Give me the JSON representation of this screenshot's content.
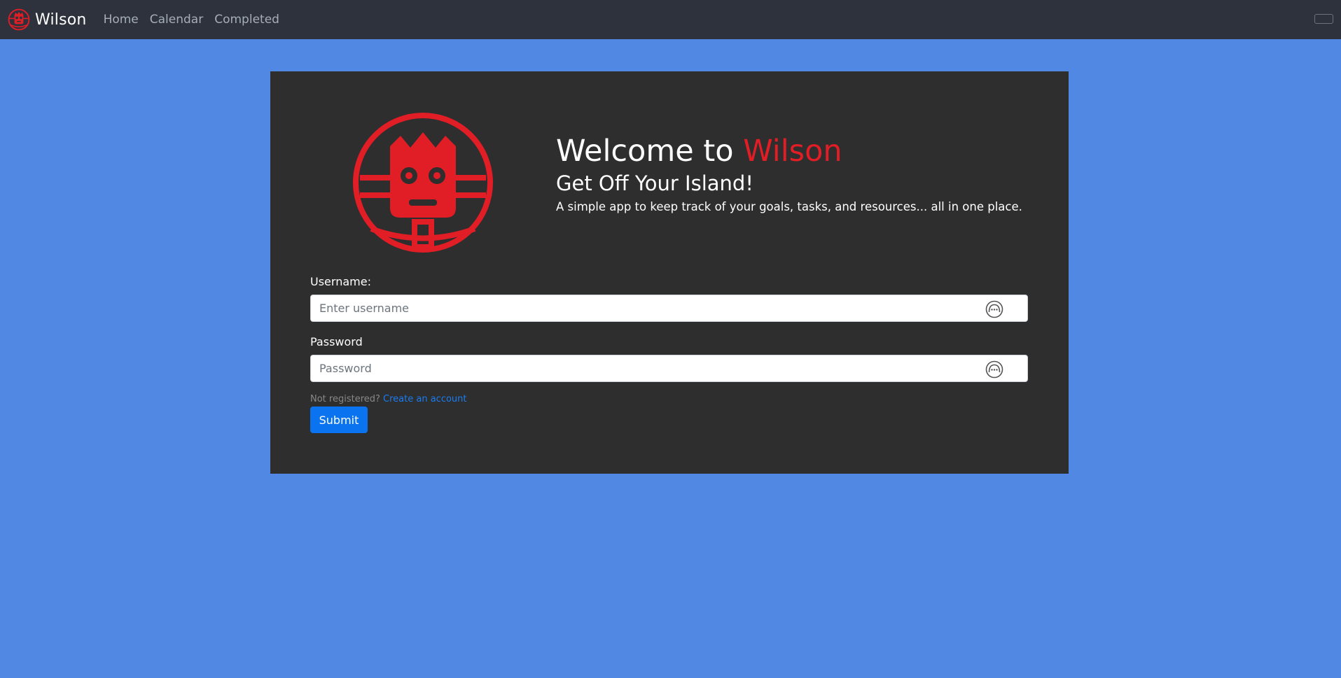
{
  "app": {
    "brand_name": "Wilson",
    "colors": {
      "page_background": "#5088e3",
      "navbar_background": "#2d323c",
      "card_background": "#2e2e2e",
      "accent_red": "#e11d26",
      "primary_blue": "#0a74f0",
      "link_blue": "#1a7cf0"
    }
  },
  "navbar": {
    "logo_icon": "wilson-face-icon",
    "brand": "Wilson",
    "links": [
      {
        "label": "Home"
      },
      {
        "label": "Calendar"
      },
      {
        "label": "Completed"
      }
    ],
    "toggler_icon": "menu-toggle-icon"
  },
  "hero": {
    "logo_icon": "wilson-face-logo",
    "title_prefix": "Welcome to ",
    "title_accent": "Wilson",
    "subtitle": "Get Off Your Island!",
    "description": "A simple app to keep track of your goals, tasks, and resources... all in one place."
  },
  "form": {
    "username": {
      "label": "Username:",
      "placeholder": "Enter username",
      "value": "",
      "icon": "password-manager-icon"
    },
    "password": {
      "label": "Password",
      "placeholder": "Password",
      "value": "",
      "icon": "password-manager-icon"
    },
    "register_prompt": "Not registered?",
    "register_link": "Create an account",
    "submit_label": "Submit"
  }
}
